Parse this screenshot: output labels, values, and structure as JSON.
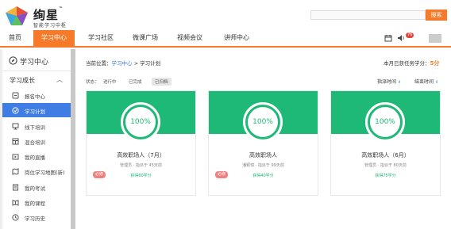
{
  "brand": {
    "name": "绚星",
    "tm": "™",
    "subtitle": "智能学习中枢"
  },
  "search": {
    "button_label": "搜索",
    "placeholder": ""
  },
  "nav": {
    "items": [
      "首页",
      "学习中心",
      "学习社区",
      "微课广场",
      "视频会议",
      "讲师中心"
    ],
    "active_index": 1,
    "notification_count": "76"
  },
  "sidebar": {
    "title": "学习中心",
    "section": "学习成长",
    "items": [
      {
        "label": "报名中心",
        "icon": "signup-icon"
      },
      {
        "label": "学习计划",
        "icon": "plan-icon"
      },
      {
        "label": "线下培训",
        "icon": "offline-training-icon"
      },
      {
        "label": "混合培训",
        "icon": "mixed-training-icon"
      },
      {
        "label": "我的直播",
        "icon": "live-icon"
      },
      {
        "label": "岗位学习地图(新)",
        "icon": "map-icon"
      },
      {
        "label": "我的考试",
        "icon": "exam-icon"
      },
      {
        "label": "我的课程",
        "icon": "course-icon"
      },
      {
        "label": "学习历史",
        "icon": "history-icon"
      }
    ],
    "active_index": 1
  },
  "main": {
    "breadcrumb_prefix": "当前位置：",
    "breadcrumb_link": "学习中心",
    "breadcrumb_sep": " > ",
    "breadcrumb_current": "学习计划",
    "score_label": "本月已获任务学分：",
    "score_value": "5分",
    "status_label": "状态：",
    "status_filters": [
      "进行中",
      "已完成",
      "已归档"
    ],
    "selected_status": 2,
    "sort_options": [
      {
        "label": "指派时间",
        "arrow": "⇕"
      },
      {
        "label": "结束时间",
        "arrow": "⇕"
      }
    ],
    "cards": [
      {
        "progress": "100%",
        "title": "高效职场人（7月）",
        "meta": "管理员 · 指派于 45天前",
        "points": "获得60学分",
        "tag": "必修"
      },
      {
        "progress": "100%",
        "title": "高效职场人",
        "meta": "潘颖琪 · 指派于 99天前",
        "points": "获得40学分",
        "tag": "必修"
      },
      {
        "progress": "100%",
        "title": "高效职场人（6月）",
        "meta": "管理员 · 指派于 80天前",
        "points": "获得75学分",
        "tag": ""
      }
    ]
  },
  "colors": {
    "accent": "#f77a2a",
    "blue": "#3f7ce3",
    "green": "#1fb977",
    "tag": "#f08080"
  }
}
